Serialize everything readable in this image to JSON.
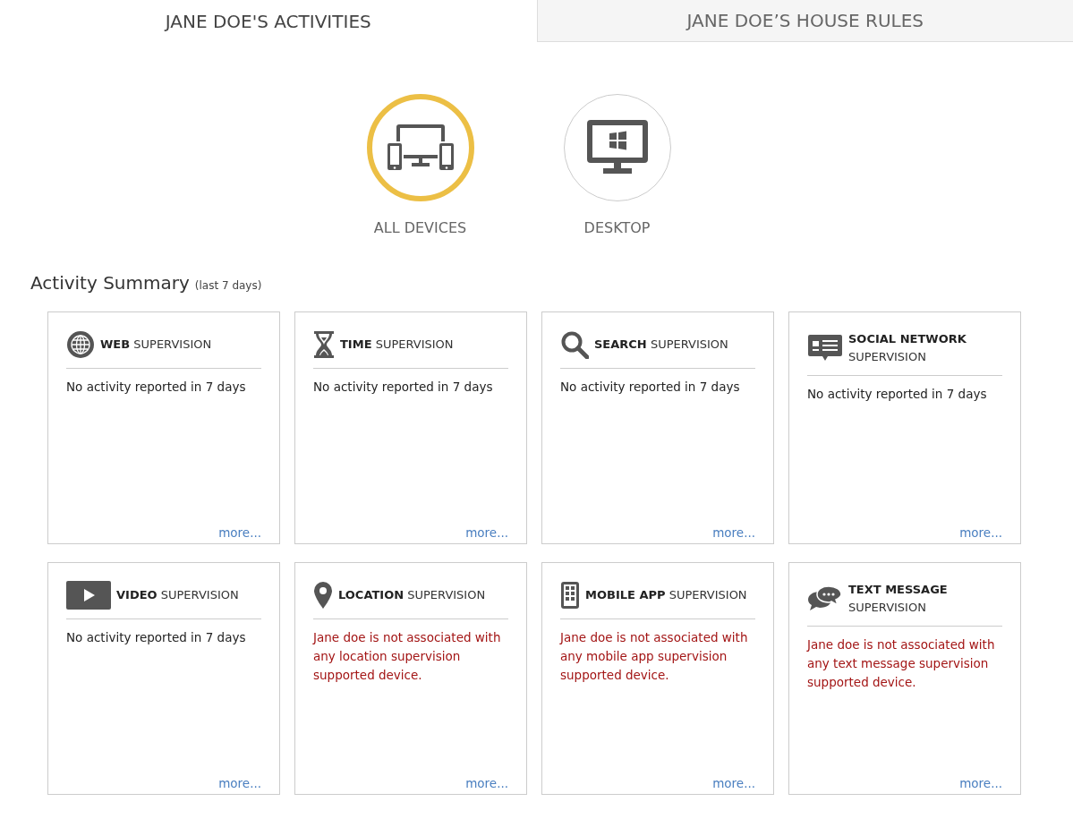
{
  "tabs": [
    {
      "label": "JANE DOE'S ACTIVITIES",
      "selected": true
    },
    {
      "label": "JANE DOE’S HOUSE RULES",
      "selected": false
    }
  ],
  "devices": [
    {
      "label": "ALL DEVICES",
      "kind": "all",
      "selected": true
    },
    {
      "label": "DESKTOP",
      "kind": "desktop",
      "selected": false
    }
  ],
  "summary": {
    "title": "Activity Summary",
    "note": "(last 7 days)"
  },
  "cards": [
    {
      "title": "**WEB** SUPERVISION",
      "message": "No activity reported in 7 days",
      "kind": "info",
      "link": "more..."
    },
    {
      "title": "**TIME** SUPERVISION",
      "message": "No activity reported in 7 days",
      "kind": "info",
      "link": "more..."
    },
    {
      "title": "**SEARCH** SUPERVISION",
      "message": "No activity reported in 7 days",
      "kind": "info",
      "link": "more..."
    },
    {
      "title": "**SOCIAL NETWORK** SUPERVISION",
      "message": "No activity reported in 7 days",
      "kind": "info",
      "link": "more..."
    },
    {
      "title": "**VIDEO** SUPERVISION",
      "message": "No activity reported in 7 days",
      "kind": "info",
      "link": "more..."
    },
    {
      "title": "**LOCATION** SUPERVISION",
      "message": "Jane doe is not associated with any location supervision supported device.",
      "kind": "warning",
      "link": "more..."
    },
    {
      "title": "**MOBILE APP** SUPERVISION",
      "message": "Jane doe is not associated with any mobile app supervision supported device.",
      "kind": "warning",
      "link": "more..."
    },
    {
      "title": "**TEXT MESSAGE** SUPERVISION",
      "message": "Jane doe is not associated with any text message supervision supported device.",
      "kind": "warning",
      "link": "more..."
    }
  ]
}
